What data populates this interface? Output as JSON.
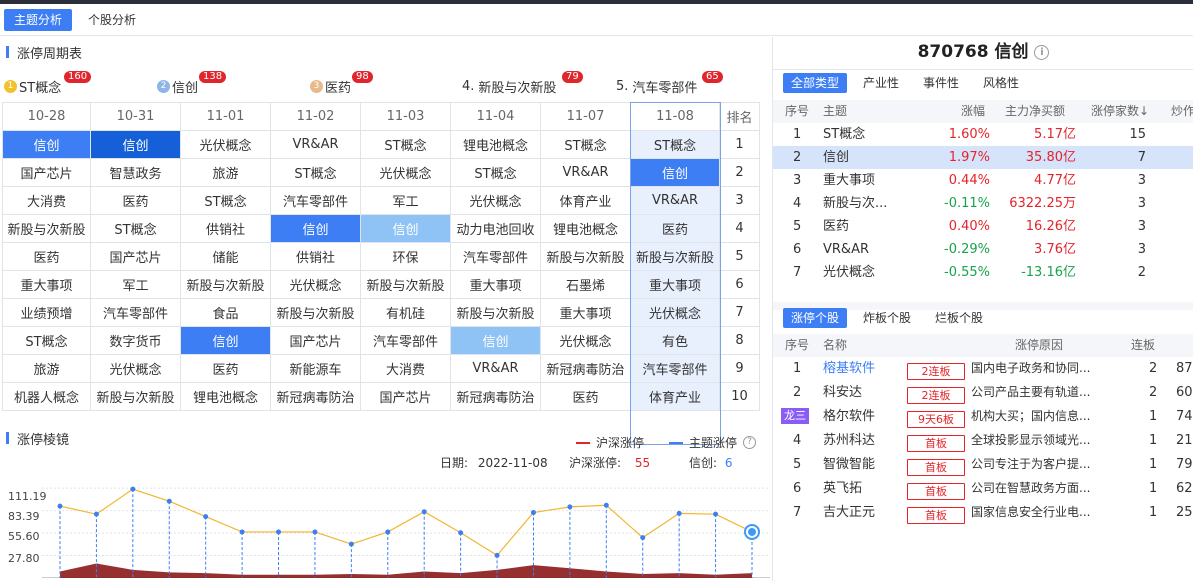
{
  "tabs": [
    {
      "label": "主题分析"
    },
    {
      "label": "个股分析"
    }
  ],
  "cycle": {
    "title": "涨停周期表",
    "topics": [
      {
        "rank": "1",
        "name": "ST概念",
        "count": "160"
      },
      {
        "rank": "2",
        "name": "信创",
        "count": "138"
      },
      {
        "rank": "3",
        "name": "医药",
        "count": "98"
      },
      {
        "rank": "4.",
        "name": "新股与次新股",
        "count": "79"
      },
      {
        "rank": "5.",
        "name": "汽车零部件",
        "count": "65"
      }
    ],
    "dates": [
      "10-28",
      "10-31",
      "11-01",
      "11-02",
      "11-03",
      "11-04",
      "11-07",
      "11-08"
    ],
    "rank_header": "排名",
    "rows": [
      [
        "信创",
        "信创",
        "光伏概念",
        "VR&AR",
        "ST概念",
        "锂电池概念",
        "ST概念",
        "ST概念"
      ],
      [
        "国产芯片",
        "智慧政务",
        "旅游",
        "ST概念",
        "光伏概念",
        "ST概念",
        "VR&AR",
        "信创"
      ],
      [
        "大消费",
        "医药",
        "ST概念",
        "汽车零部件",
        "军工",
        "光伏概念",
        "体育产业",
        "VR&AR"
      ],
      [
        "新股与次新股",
        "ST概念",
        "供销社",
        "信创",
        "信创",
        "动力电池回收",
        "锂电池概念",
        "医药"
      ],
      [
        "医药",
        "国产芯片",
        "储能",
        "供销社",
        "环保",
        "汽车零部件",
        "新股与次新股",
        "新股与次新股"
      ],
      [
        "重大事项",
        "军工",
        "新股与次新股",
        "光伏概念",
        "新股与次新股",
        "重大事项",
        "石墨烯",
        "重大事项"
      ],
      [
        "业绩预增",
        "汽车零部件",
        "食品",
        "新股与次新股",
        "有机硅",
        "新股与次新股",
        "重大事项",
        "光伏概念"
      ],
      [
        "ST概念",
        "数字货币",
        "信创",
        "国产芯片",
        "汽车零部件",
        "信创",
        "光伏概念",
        "有色"
      ],
      [
        "旅游",
        "光伏概念",
        "医药",
        "新能源车",
        "大消费",
        "VR&AR",
        "新冠病毒防治",
        "汽车零部件"
      ],
      [
        "机器人概念",
        "新股与次新股",
        "锂电池概念",
        "新冠病毒防治",
        "国产芯片",
        "新冠病毒防治",
        "医药",
        "体育产业"
      ]
    ],
    "ranks": [
      "1",
      "2",
      "3",
      "4",
      "5",
      "6",
      "7",
      "8",
      "9",
      "10"
    ]
  },
  "prism": {
    "title": "涨停棱镜",
    "legend_a": "沪深涨停",
    "legend_b": "主题涨停",
    "help": "?",
    "date_label": "日期:",
    "date_value": "2022-11-08",
    "hs_label": "沪深涨停:",
    "hs_value": "55",
    "topic_label": "信创:",
    "topic_value": "6",
    "yticks": [
      "111.19",
      "83.39",
      "55.60",
      "27.80"
    ]
  },
  "chart_data": {
    "type": "line",
    "ylim": [
      0,
      125
    ],
    "yticks": [
      27.8,
      55.6,
      83.39,
      111.19
    ],
    "series": [
      {
        "values": [
          89,
          79,
          110,
          95,
          76,
          57,
          57,
          57,
          42,
          57,
          82,
          56,
          28,
          81,
          88,
          90,
          50,
          80,
          79,
          57
        ]
      },
      {
        "values": [
          8,
          18,
          10,
          7,
          6,
          4,
          4,
          4,
          5,
          4,
          8,
          6,
          10,
          16,
          12,
          8,
          5,
          6,
          4,
          6
        ]
      }
    ],
    "colors": {
      "line": "#f2b630",
      "area": "#8b1a1a",
      "stem": "#3d7ef5"
    }
  },
  "stock": {
    "code": "870768",
    "name": "信创",
    "info": "i",
    "filters": [
      {
        "label": "全部类型"
      },
      {
        "label": "产业性"
      },
      {
        "label": "事件性"
      },
      {
        "label": "风格性"
      }
    ],
    "topic_headers": {
      "no": "序号",
      "theme": "主题",
      "chg": "涨幅",
      "flow": "主力净买额",
      "count": "涨停家数↓",
      "heat": "炒作次"
    },
    "topics": [
      {
        "no": "1",
        "theme": "ST概念",
        "chg": "1.60%",
        "flow": "5.17亿",
        "count": "15"
      },
      {
        "no": "2",
        "theme": "信创",
        "chg": "1.97%",
        "flow": "35.80亿",
        "count": "7"
      },
      {
        "no": "3",
        "theme": "重大事项",
        "chg": "0.44%",
        "flow": "4.77亿",
        "count": "3"
      },
      {
        "no": "4",
        "theme": "新股与次...",
        "chg": "-0.11%",
        "flow": "6322.25万",
        "count": "3"
      },
      {
        "no": "5",
        "theme": "医药",
        "chg": "0.40%",
        "flow": "16.26亿",
        "count": "3"
      },
      {
        "no": "6",
        "theme": "VR&AR",
        "chg": "-0.29%",
        "flow": "3.76亿",
        "count": "3"
      },
      {
        "no": "7",
        "theme": "光伏概念",
        "chg": "-0.55%",
        "flow": "-13.16亿",
        "count": "2"
      }
    ],
    "stock_tabs": [
      {
        "label": "涨停个股"
      },
      {
        "label": "炸板个股"
      },
      {
        "label": "烂板个股"
      }
    ],
    "stock_headers": {
      "no": "序号",
      "name": "名称",
      "reason": "涨停原因",
      "lb": "连板"
    },
    "stocks": [
      {
        "no": "1",
        "name": "榕基软件",
        "tag": "2连板",
        "reason": "国内电子政务和协同...",
        "lb": "2",
        "extra": "87"
      },
      {
        "no": "2",
        "name": "科安达",
        "tag": "2连板",
        "reason": "公司产品主要有轨道...",
        "lb": "2",
        "extra": "60"
      },
      {
        "no": "龙三",
        "name": "格尔软件",
        "tag": "9天6板",
        "reason": "机构大买；国内信息...",
        "lb": "1",
        "extra": "74"
      },
      {
        "no": "4",
        "name": "苏州科达",
        "tag": "首板",
        "reason": "全球投影显示领域光...",
        "lb": "1",
        "extra": "21"
      },
      {
        "no": "5",
        "name": "智微智能",
        "tag": "首板",
        "reason": "公司专注于为客户提...",
        "lb": "1",
        "extra": "79"
      },
      {
        "no": "6",
        "name": "英飞拓",
        "tag": "首板",
        "reason": "公司在智慧政务方面...",
        "lb": "1",
        "extra": "62"
      },
      {
        "no": "7",
        "name": "吉大正元",
        "tag": "首板",
        "reason": "国家信息安全行业电...",
        "lb": "1",
        "extra": "25"
      }
    ]
  }
}
